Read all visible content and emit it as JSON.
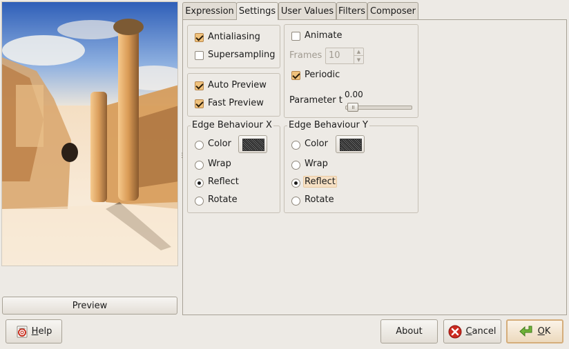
{
  "tabs": [
    {
      "label": "Expression"
    },
    {
      "label": "Settings"
    },
    {
      "label": "User Values"
    },
    {
      "label": "Filters"
    },
    {
      "label": "Composer"
    }
  ],
  "preview": {
    "button_label": "Preview"
  },
  "rendering": {
    "antialiasing": {
      "label": "Antialiasing",
      "checked": true
    },
    "supersampling": {
      "label": "Supersampling",
      "checked": false
    }
  },
  "preview_options": {
    "auto_preview": {
      "label": "Auto Preview",
      "checked": true
    },
    "fast_preview": {
      "label": "Fast Preview",
      "checked": true
    }
  },
  "animation": {
    "animate": {
      "label": "Animate",
      "checked": false
    },
    "frames_label": "Frames",
    "frames_value": "10",
    "periodic": {
      "label": "Periodic",
      "checked": true
    },
    "parameter_label": "Parameter t",
    "parameter_value": "0.00"
  },
  "edge_x": {
    "title": "Edge Behaviour X",
    "options": [
      "Color",
      "Wrap",
      "Reflect",
      "Rotate"
    ],
    "selected": "Reflect"
  },
  "edge_y": {
    "title": "Edge Behaviour Y",
    "options": [
      "Color",
      "Wrap",
      "Reflect",
      "Rotate"
    ],
    "selected": "Reflect"
  },
  "buttons": {
    "help": {
      "mnemonic": "H",
      "rest": "elp"
    },
    "about": "About",
    "cancel": {
      "mnemonic": "C",
      "rest": "ancel"
    },
    "ok": {
      "mnemonic": "O",
      "rest": "K"
    }
  },
  "colors": {
    "check_on": "#f0c27c",
    "default_button_border": "#d5ad7a",
    "background": "#edeae5"
  },
  "icons": {
    "help": "help-icon",
    "cancel": "cancel-icon",
    "ok": "ok-arrow-icon"
  }
}
